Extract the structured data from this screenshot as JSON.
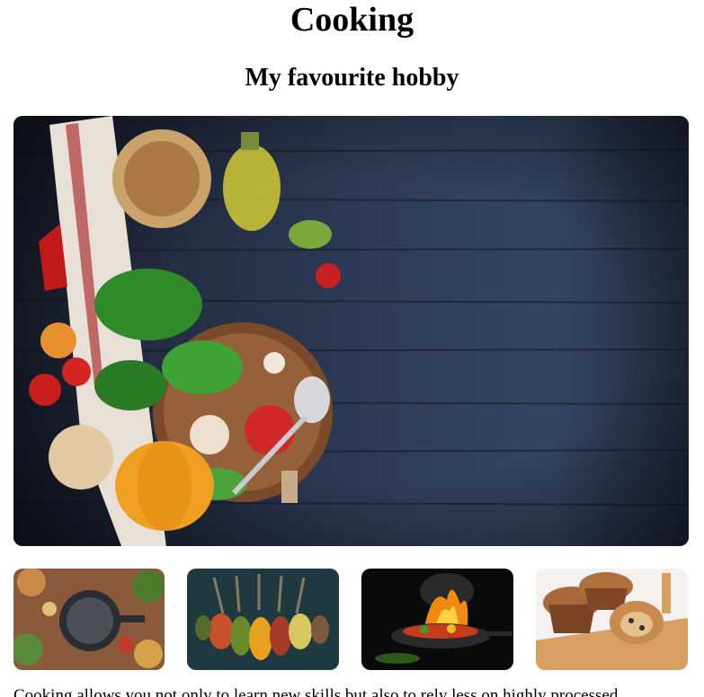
{
  "page": {
    "title": "Cooking",
    "subtitle": "My favourite hobby",
    "intro": "Cooking allows you not only to learn new skills but also to rely less on highly processed"
  },
  "images": {
    "hero": "cooking-ingredients-photo",
    "gallery": [
      "cooking-pot-spices-photo",
      "spice-spoons-photo",
      "flaming-wok-photo",
      "muffins-photo"
    ]
  }
}
